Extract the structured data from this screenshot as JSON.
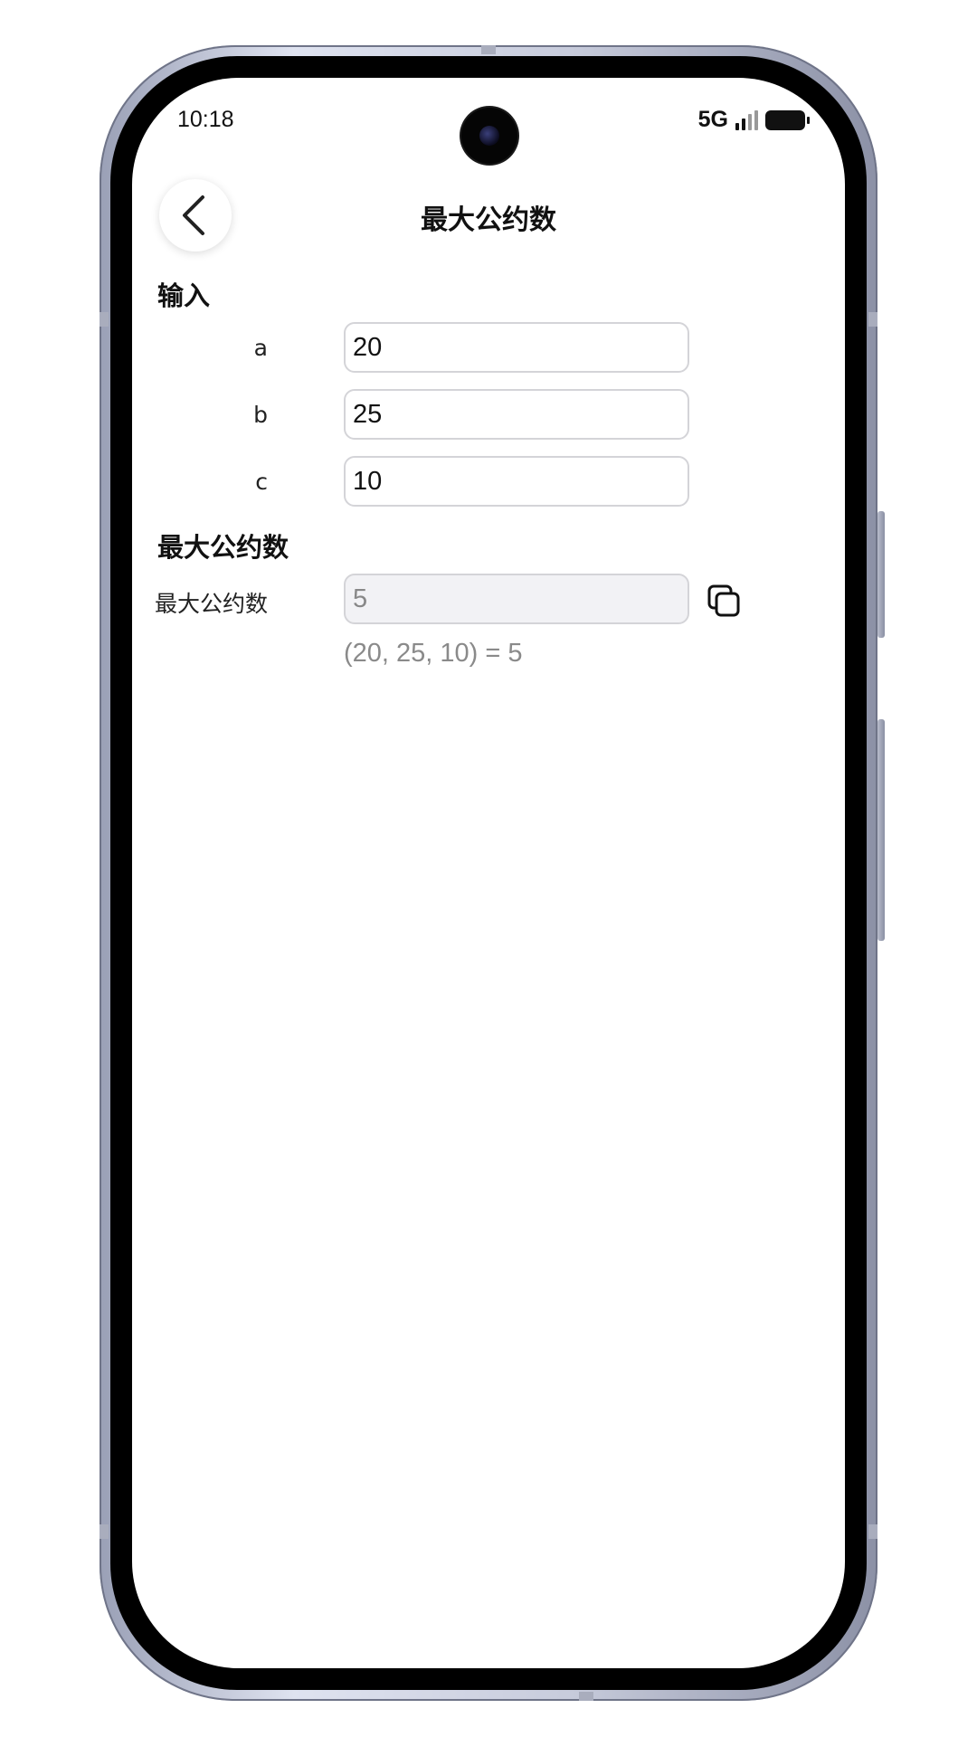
{
  "status_bar": {
    "time": "10:18",
    "network": "5G"
  },
  "header": {
    "title": "最大公约数"
  },
  "input_section": {
    "heading": "输入",
    "fields": [
      {
        "label": "a",
        "value": "20"
      },
      {
        "label": "b",
        "value": "25"
      },
      {
        "label": "c",
        "value": "10"
      }
    ]
  },
  "result_section": {
    "heading": "最大公约数",
    "label": "最大公约数",
    "value": "5",
    "formula": "(20, 25, 10) = 5"
  },
  "icons": {
    "back": "chevron-left-icon",
    "copy": "copy-icon"
  }
}
